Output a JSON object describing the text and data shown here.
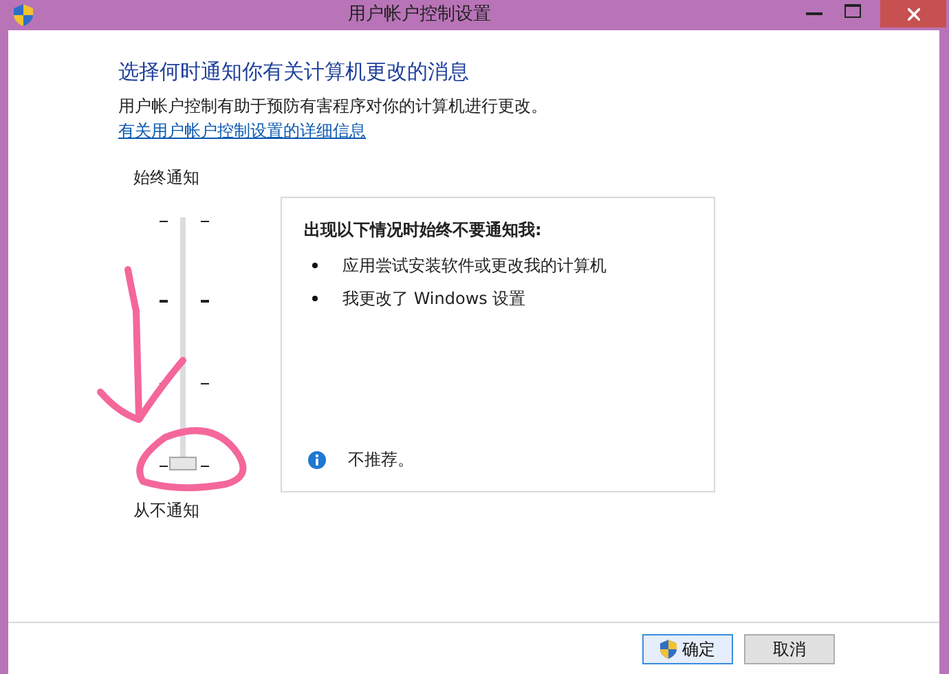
{
  "window": {
    "title": "用户帐户控制设置"
  },
  "heading": "选择何时通知你有关计算机更改的消息",
  "description": "用户帐户控制有助于预防有害程序对你的计算机进行更改。",
  "link": "有关用户帐户控制设置的详细信息",
  "slider": {
    "top_label": "始终通知",
    "bottom_label": "从不通知",
    "level": 0
  },
  "info_panel": {
    "title": "出现以下情况时始终不要通知我:",
    "bullets": [
      "应用尝试安装软件或更改我的计算机",
      "我更改了 Windows 设置"
    ],
    "note": "不推荐。"
  },
  "buttons": [
    {
      "label": "确定",
      "kind": "shield"
    },
    {
      "label": "取消",
      "kind": "plain"
    }
  ]
}
